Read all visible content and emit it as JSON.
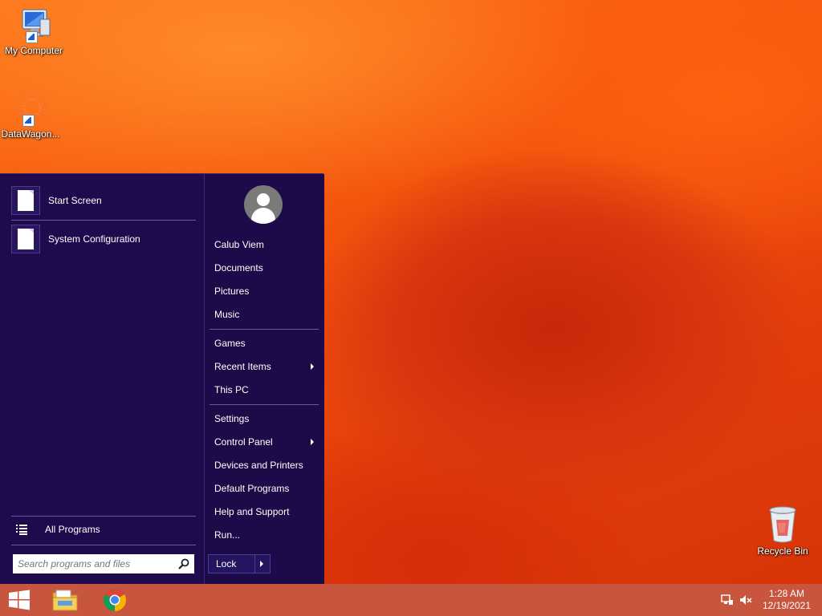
{
  "desktop": {
    "icons": [
      {
        "label": "My Computer"
      },
      {
        "label": "DataWagon..."
      },
      {
        "label": "Recycle Bin"
      }
    ]
  },
  "start_menu": {
    "pinned": [
      {
        "label": "Start Screen"
      },
      {
        "label": "System Configuration"
      }
    ],
    "all_programs": "All Programs",
    "search": {
      "placeholder": "Search programs and files"
    },
    "user": {
      "name": "Calub Viem"
    },
    "right_items": {
      "documents": "Documents",
      "pictures": "Pictures",
      "music": "Music",
      "games": "Games",
      "recent_items": "Recent Items",
      "this_pc": "This PC",
      "settings": "Settings",
      "control_panel": "Control Panel",
      "devices_printers": "Devices and Printers",
      "default_programs": "Default Programs",
      "help_support": "Help and Support",
      "run": "Run..."
    },
    "lock": "Lock"
  },
  "taskbar": {
    "time": "1:28 AM",
    "date": "12/19/2021",
    "apps": [
      "File Explorer",
      "Google Chrome"
    ]
  },
  "colors": {
    "menu_bg": "#1d0a49",
    "taskbar": "#c8563e",
    "desktop_accent": "#f2520c"
  }
}
